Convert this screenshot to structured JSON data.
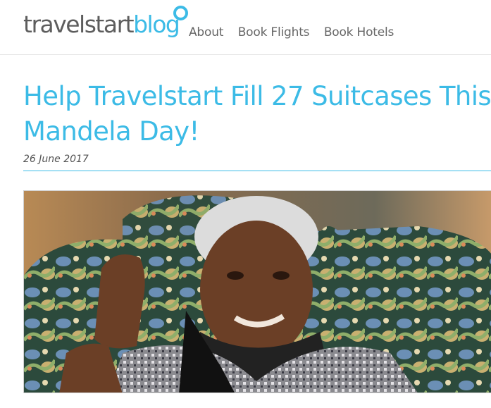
{
  "header": {
    "logo": {
      "part1": "travelstart",
      "part2": "blog"
    },
    "nav": [
      {
        "label": "About"
      },
      {
        "label": "Book Flights"
      },
      {
        "label": "Book Hotels"
      }
    ]
  },
  "post": {
    "title": "Help Travelstart Fill 27 Suitcases This Mandela Day!",
    "date": "26 June 2017"
  },
  "colors": {
    "accent": "#3cbbe6",
    "text": "#555555"
  }
}
